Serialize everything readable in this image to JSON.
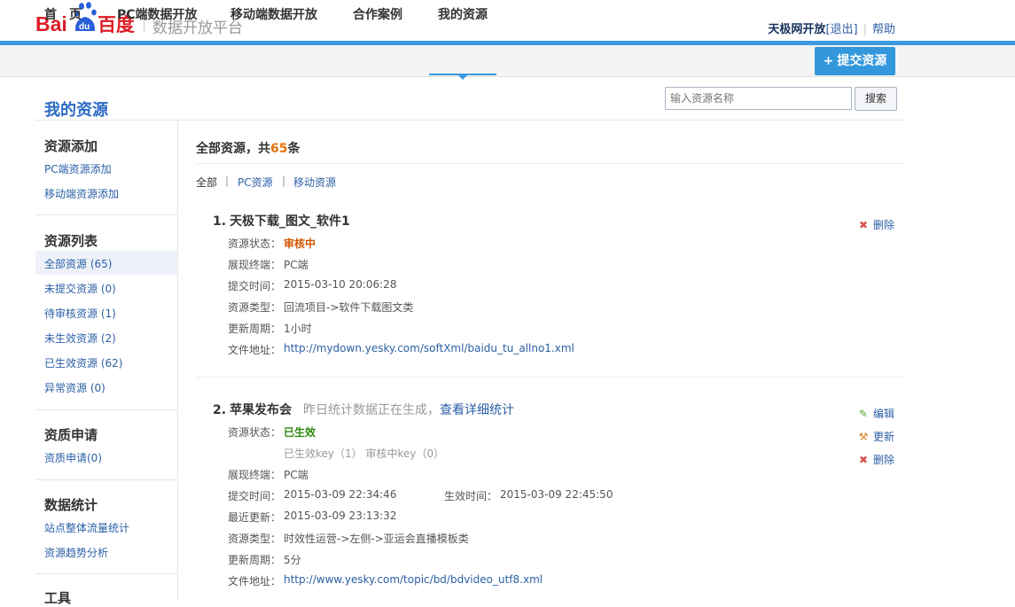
{
  "header": {
    "logo": {
      "bai": "Bai",
      "du": "du",
      "cn": "百度"
    },
    "platform": "数据开放平台",
    "user": "天极网开放",
    "logout": "[退出]",
    "separator": "|",
    "help": "帮助"
  },
  "nav": {
    "items": [
      "首　页",
      "PC端数据开放",
      "移动端数据开放",
      "合作案例",
      "我的资源"
    ],
    "submit_plus": "+",
    "submit": "提交资源"
  },
  "page": {
    "title": "我的资源",
    "search_placeholder": "输入资源名称",
    "search_button": "搜索"
  },
  "sidebar": {
    "add": {
      "heading": "资源添加",
      "items": [
        "PC端资源添加",
        "移动端资源添加"
      ]
    },
    "list": {
      "heading": "资源列表",
      "items": [
        "全部资源 (65)",
        "未提交资源 (0)",
        "待审核资源 (1)",
        "未生效资源 (2)",
        "已生效资源 (62)",
        "异常资源 (0)"
      ]
    },
    "qual": {
      "heading": "资质申请",
      "items": [
        "资质申请(0)"
      ]
    },
    "stats": {
      "heading": "数据统计",
      "items": [
        "站点整体流量统计",
        "资源趋势分析"
      ]
    },
    "tools": {
      "heading": "工具"
    }
  },
  "main": {
    "total_prefix": "全部资源，共",
    "total_count": "65",
    "total_suffix": "条",
    "filters": [
      "全部",
      "PC资源",
      "移动资源"
    ],
    "filter_sep": "|",
    "resources": [
      {
        "index": "1.",
        "title": "天极下载_图文_软件1",
        "fields": {
          "status_label": "资源状态：",
          "status": "审核中",
          "terminal_label": "展现终端：",
          "terminal": "PC端",
          "submit_label": "提交时间：",
          "submit": "2015-03-10 20:06:28",
          "type_label": "资源类型：",
          "type": "回流项目->软件下载图文类",
          "cycle_label": "更新周期：",
          "cycle": "1小时",
          "url_label": "文件地址：",
          "url": "http://mydown.yesky.com/softXml/baidu_tu_allno1.xml"
        },
        "actions": {
          "delete": "删除"
        }
      },
      {
        "index": "2.",
        "title": "苹果发布会",
        "note": "昨日统计数据正在生成，",
        "note_link": "查看详细统计",
        "fields": {
          "status_label": "资源状态：",
          "status": "已生效",
          "keys": "已生效key（1）  审核中key（0）",
          "terminal_label": "展现终端：",
          "terminal": "PC端",
          "submit_label": "提交时间：",
          "submit": "2015-03-09 22:34:46",
          "effective_label": "生效时间：",
          "effective": "2015-03-09 22:45:50",
          "updated_label": "最近更新：",
          "updated": "2015-03-09 23:13:32",
          "type_label": "资源类型：",
          "type": "时效性运营->左侧->亚运会直播模板类",
          "cycle_label": "更新周期：",
          "cycle": "5分",
          "url_label": "文件地址：",
          "url": "http://www.yesky.com/topic/bd/bdvideo_utf8.xml"
        },
        "actions": {
          "edit": "编辑",
          "update": "更新",
          "delete": "删除"
        }
      }
    ]
  },
  "colors": {
    "brand_red": "#de1c26",
    "brand_blue": "#2a5fd9",
    "accent": "#3b9ae0",
    "pending": "#d35400",
    "active": "#2e8b0f",
    "count": "#e8730e"
  },
  "icons": [
    "baidu-paw-icon",
    "plus-icon",
    "delete-icon",
    "edit-icon",
    "update-icon"
  ]
}
